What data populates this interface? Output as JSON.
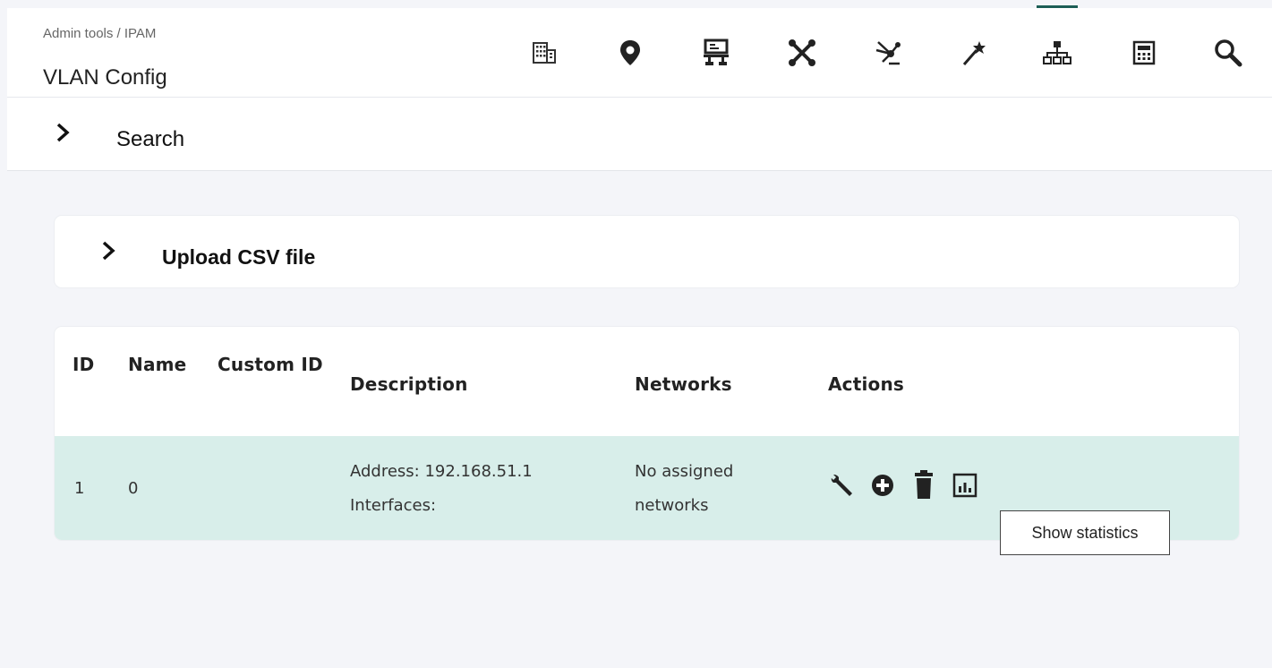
{
  "header": {
    "breadcrumb": "Admin tools / IPAM",
    "title": "VLAN Config",
    "toolbar": [
      {
        "icon": "building-icon"
      },
      {
        "icon": "location-pin-icon"
      },
      {
        "icon": "server-icon"
      },
      {
        "icon": "network-graph-icon"
      },
      {
        "icon": "link-icon"
      },
      {
        "icon": "magic-wand-icon"
      },
      {
        "icon": "sitemap-icon",
        "active": true
      },
      {
        "icon": "calculator-icon"
      },
      {
        "icon": "search-icon"
      }
    ]
  },
  "search_section": {
    "label": "Search"
  },
  "upload_section": {
    "label": "Upload CSV file"
  },
  "table": {
    "headers": {
      "id": "ID",
      "name": "Name",
      "custom_id": "Custom ID",
      "description": "Description",
      "networks": "Networks",
      "actions": "Actions"
    },
    "rows": [
      {
        "id": "1",
        "name": "0",
        "custom_id": "",
        "description_line1": "Address: 192.168.51.1",
        "description_line2": "Interfaces:",
        "networks_line1": "No assigned",
        "networks_line2": "networks",
        "actions": [
          "wrench-icon",
          "plus-circle-icon",
          "trash-icon",
          "statistics-icon"
        ]
      }
    ]
  },
  "tooltip": {
    "text": "Show statistics"
  },
  "colors": {
    "accent": "#1d5e56",
    "row_highlight": "#d8eeea",
    "background": "#f4f5f9"
  }
}
